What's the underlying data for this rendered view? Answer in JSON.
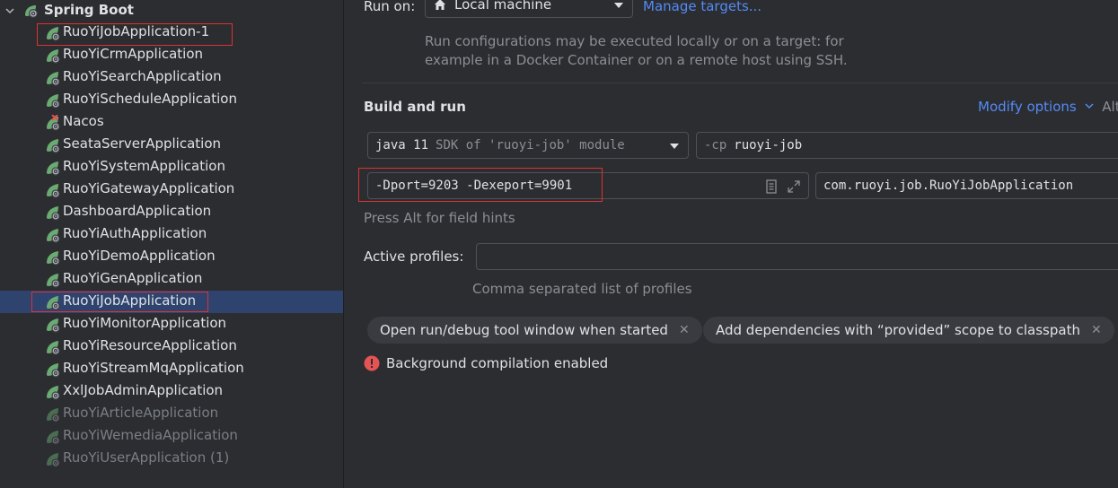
{
  "tree": {
    "group_label": "Spring Boot",
    "items": [
      {
        "label": "RuoYiJobApplication-1",
        "state": "normal"
      },
      {
        "label": "RuoYiCrmApplication",
        "state": "normal"
      },
      {
        "label": "RuoYiSearchApplication",
        "state": "normal"
      },
      {
        "label": "RuoYiScheduleApplication",
        "state": "normal"
      },
      {
        "label": "Nacos",
        "state": "error"
      },
      {
        "label": "SeataServerApplication",
        "state": "normal"
      },
      {
        "label": "RuoYiSystemApplication",
        "state": "normal"
      },
      {
        "label": "RuoYiGatewayApplication",
        "state": "normal"
      },
      {
        "label": "DashboardApplication",
        "state": "normal"
      },
      {
        "label": "RuoYiAuthApplication",
        "state": "normal"
      },
      {
        "label": "RuoYiDemoApplication",
        "state": "normal"
      },
      {
        "label": "RuoYiGenApplication",
        "state": "normal"
      },
      {
        "label": "RuoYiJobApplication",
        "state": "selected"
      },
      {
        "label": "RuoYiMonitorApplication",
        "state": "normal"
      },
      {
        "label": "RuoYiResourceApplication",
        "state": "normal"
      },
      {
        "label": "RuoYiStreamMqApplication",
        "state": "normal"
      },
      {
        "label": "XxlJobAdminApplication",
        "state": "normal"
      },
      {
        "label": "RuoYiArticleApplication",
        "state": "disabled"
      },
      {
        "label": "RuoYiWemediaApplication",
        "state": "disabled"
      },
      {
        "label": "RuoYiUserApplication (1)",
        "state": "disabled"
      }
    ]
  },
  "run_on": {
    "label": "Run on:",
    "value": "Local machine",
    "manage_link": "Manage targets...",
    "description_line1": "Run configurations may be executed locally or on a target: for",
    "description_line2": "example in a Docker Container or on a remote host using SSH."
  },
  "build_run": {
    "title": "Build and run",
    "modify_options": "Modify options",
    "modify_shortcut": "Alt",
    "jdk_main": "java 11",
    "jdk_detail": "SDK of 'ruoyi-job' module",
    "cp_flag": "-cp",
    "cp_value": "ruoyi-job",
    "vm_options": "-Dport=9203 -Dexeport=9901",
    "main_class": "com.ruoyi.job.RuoYiJobApplication",
    "field_hint": "Press Alt for field hints"
  },
  "profiles": {
    "label": "Active profiles:",
    "value": "",
    "hint": "Comma separated list of profiles"
  },
  "chips": [
    {
      "label": "Open run/debug tool window when started"
    },
    {
      "label": "Add dependencies with “provided” scope to classpath"
    }
  ],
  "warning": {
    "text": "Background compilation enabled"
  },
  "colors": {
    "background": "#2b2d30",
    "selection": "#2e436e",
    "link": "#548af7",
    "highlight_box": "#e03131",
    "spring_green": "#6aab73",
    "error_red": "#e55353"
  }
}
